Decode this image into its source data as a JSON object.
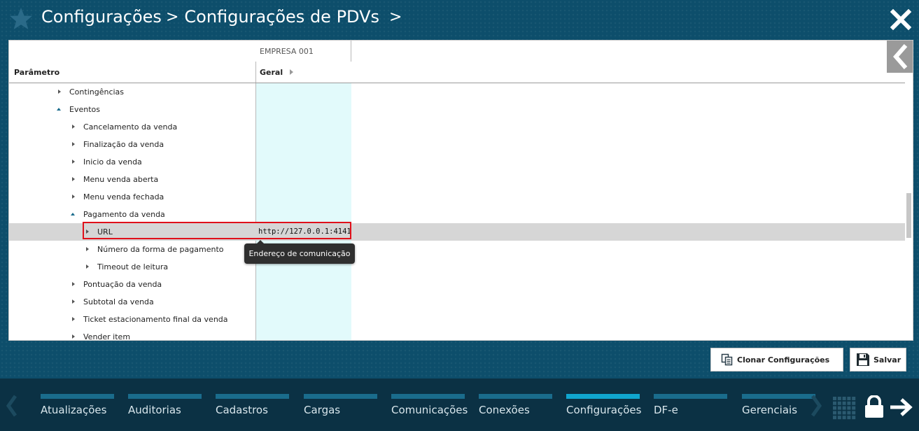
{
  "header": {
    "breadcrumb": [
      "Configurações",
      "Configurações de PDVs"
    ],
    "separator": ">",
    "trailing_chevron": ">",
    "star_icon": "star-icon",
    "close_icon": "close-icon"
  },
  "grid": {
    "company_column": "EMPRESA 001",
    "param_header": "Parâmetro",
    "group_header": "Geral",
    "rows": [
      {
        "label": "Contingências",
        "level": 2,
        "state": "collapsed",
        "value": ""
      },
      {
        "label": "Eventos",
        "level": 2,
        "state": "expanded",
        "value": ""
      },
      {
        "label": "Cancelamento da venda",
        "level": 3,
        "state": "collapsed",
        "value": ""
      },
      {
        "label": "Finalização da venda",
        "level": 3,
        "state": "collapsed",
        "value": ""
      },
      {
        "label": "Inicio da venda",
        "level": 3,
        "state": "collapsed",
        "value": ""
      },
      {
        "label": "Menu venda aberta",
        "level": 3,
        "state": "collapsed",
        "value": ""
      },
      {
        "label": "Menu venda fechada",
        "level": 3,
        "state": "collapsed",
        "value": ""
      },
      {
        "label": "Pagamento da venda",
        "level": 3,
        "state": "expanded",
        "value": ""
      },
      {
        "label": "URL",
        "level": 4,
        "state": "collapsed",
        "value": "http://127.0.0.1:4141",
        "selected": true
      },
      {
        "label": "Número da forma de pagamento",
        "level": 4,
        "state": "collapsed",
        "value": ""
      },
      {
        "label": "Timeout de leitura",
        "level": 4,
        "state": "collapsed",
        "value": ""
      },
      {
        "label": "Pontuação da venda",
        "level": 3,
        "state": "collapsed",
        "value": ""
      },
      {
        "label": "Subtotal da venda",
        "level": 3,
        "state": "collapsed",
        "value": ""
      },
      {
        "label": "Ticket estacionamento final da venda",
        "level": 3,
        "state": "collapsed",
        "value": ""
      },
      {
        "label": "Vender item",
        "level": 3,
        "state": "collapsed",
        "value": ""
      }
    ],
    "tooltip": "Endereço de comunicação"
  },
  "actions": {
    "clone_label": "Clonar Configurações",
    "save_label": "Salvar"
  },
  "bottom_nav": {
    "items": [
      {
        "label": "Atualizações",
        "active": false
      },
      {
        "label": "Auditorias",
        "active": false
      },
      {
        "label": "Cadastros",
        "active": false
      },
      {
        "label": "Cargas",
        "active": false
      },
      {
        "label": "Comunicações",
        "active": false
      },
      {
        "label": "Conexões",
        "active": false
      },
      {
        "label": "Configurações",
        "active": true
      },
      {
        "label": "DF-e",
        "active": false
      },
      {
        "label": "Gerenciais",
        "active": false
      }
    ]
  },
  "colors": {
    "background": "#0d4e6b",
    "nav_bar": "#1a6c8c",
    "nav_bar_active": "#10a6cf",
    "highlight_border": "#e0101a",
    "value_column": "#e2fafb"
  }
}
